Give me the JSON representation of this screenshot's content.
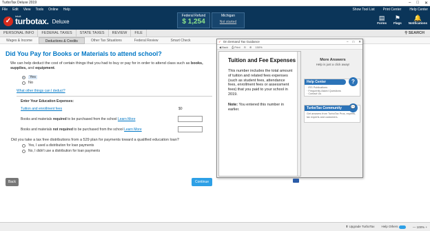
{
  "window": {
    "title": "TurboTax Deluxe 2019",
    "controls": [
      "–",
      "□",
      "✕"
    ]
  },
  "menubar": {
    "items": [
      "File",
      "Edit",
      "View",
      "Tools",
      "Online",
      "Help"
    ],
    "right": [
      "Show Tool List",
      "Print Center",
      "Help Center"
    ]
  },
  "header": {
    "brand_prefix": "intuit",
    "brand": "turbotax.",
    "edition": "Deluxe",
    "federal_label": "Federal Refund",
    "federal_value": "$ 1,254",
    "state_label": "Michigan",
    "state_value": "Not started",
    "icons": [
      {
        "label": "Forms",
        "icon": "forms-icon"
      },
      {
        "label": "Flags",
        "icon": "flag-icon"
      },
      {
        "label": "Notifications",
        "icon": "bell-icon"
      }
    ]
  },
  "nav_tabs": [
    "PERSONAL INFO",
    "FEDERAL TAXES",
    "STATE TAXES",
    "REVIEW",
    "FILE"
  ],
  "search_label": "SEARCH",
  "sub_tabs": [
    "Wages & Income",
    "Deductions & Credits",
    "Other Tax Situations",
    "Federal Review",
    "Smart Check"
  ],
  "main": {
    "title": "Did You Pay for Books or Materials to attend school?",
    "intro_prefix": "We can help deduct the cost of certain things that you had to buy or pay for in order to attend class such as ",
    "intro_bold": "books, supplies,",
    "intro_mid": " and ",
    "intro_bold2": "equipment",
    "intro_end": ".",
    "yes": "Yes",
    "no": "No",
    "deduct_link": "What other things can I deduct?",
    "enter_heading": "Enter Your Education Expenses:",
    "tuition_link": "Tuition and enrollment fees",
    "tuition_value": "$0",
    "books_req_pre": "Books and materials ",
    "books_req_bold": "required",
    "books_req_post": " to be purchased from the school ",
    "books_not_pre": "Books and materials ",
    "books_not_bold": "not required",
    "books_not_post": " to be purchased from the school ",
    "learn_more": "Learn More",
    "q529": "Did you take a tax free distributions from a 529 plan for payments toward a qualified education loan?",
    "q529_yes": "Yes, I used a distribution for loan payments",
    "q529_no": "No, I didn't use a distribution for loan payments",
    "back": "Back",
    "continue": "Continue"
  },
  "guide": {
    "title": "On Demand Tax Guidance",
    "tool_back": "Back",
    "tool_print": "Print",
    "zoom": "150%",
    "heading": "Tuition and Fee Expenses",
    "body": "This number includes the total amount of tuition and related fees expenses (such as student fees, attendance fees, enrollment fees or assessment fees) that you paid to your school in 2019.",
    "note_label": "Note:",
    "note_text": " You entered this number in earlier.",
    "more_title": "More Answers",
    "more_sub": "Help is just a click away!",
    "help_center": "Help Center",
    "help_items": [
      "· IRS Publications",
      "· Frequently Asked Questions",
      "· Contact Us"
    ],
    "community": "TurboTax Community",
    "community_text": "Get answers from TurboTax Pros, experts, tax experts and customers."
  },
  "status": {
    "upgrade": "Upgrade TurboTax",
    "help_others": "Help Others",
    "zoom": "100%"
  }
}
